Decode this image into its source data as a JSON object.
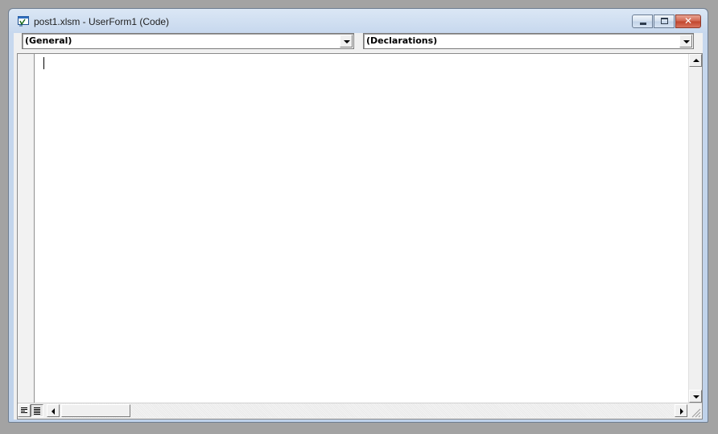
{
  "window": {
    "title": "post1.xlsm - UserForm1 (Code)",
    "icon": "vba-code-window-icon"
  },
  "controls": {
    "minimize": "minimize",
    "maximize": "maximize",
    "close": "✕"
  },
  "dropdowns": {
    "object": {
      "selected": "(General)"
    },
    "procedure": {
      "selected": "(Declarations)"
    }
  },
  "editor": {
    "code": ""
  },
  "colors": {
    "titlebar": "#c7d8ee",
    "close_button": "#c0442b",
    "editor_background": "#ffffff"
  }
}
